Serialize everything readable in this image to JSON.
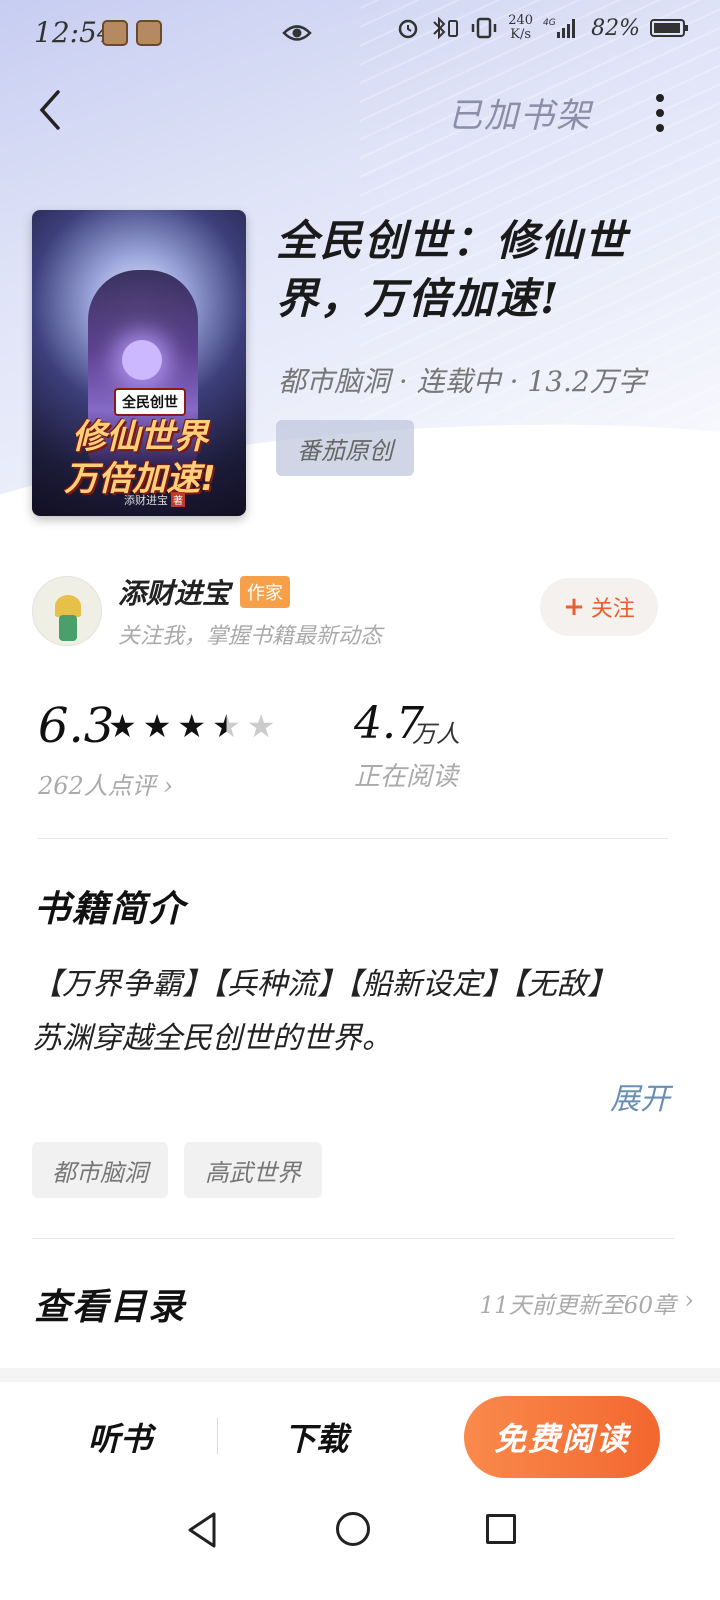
{
  "status_bar": {
    "time": "12:54",
    "speed_value": "240",
    "speed_unit": "K/s",
    "network": "4G",
    "battery": "82%"
  },
  "top_nav": {
    "shelf_label": "已加书架"
  },
  "book": {
    "cover_tag": "全民创世",
    "cover_title_line1": "修仙世界",
    "cover_title_line2": "万倍加速!",
    "cover_author": "添财进宝",
    "cover_author_badge": "著",
    "title": "全民创世：修仙世界，万倍加速!",
    "meta": "都市脑洞 · 连载中 · 13.2万字",
    "source_tag": "番茄原创"
  },
  "author": {
    "name": "添财进宝",
    "badge": "作家",
    "description": "关注我，掌握书籍最新动态",
    "follow_icon": "+",
    "follow_label": "关注"
  },
  "stats": {
    "score": "6.3",
    "stars_rating": 3.5,
    "stars_max": 5,
    "reviews_label": "262人点评 ›",
    "readers_count": "4.7",
    "readers_unit": "万人",
    "readers_label": "正在阅读"
  },
  "intro": {
    "heading": "书籍简介",
    "line1": "【万界争霸】【兵种流】【船新设定】【无敌】",
    "line2": "苏渊穿越全民创世的世界。",
    "expand_label": "展开",
    "tags": [
      "都市脑洞",
      "高武世界"
    ]
  },
  "catalog": {
    "heading": "查看目录",
    "info": "11天前更新至60章",
    "chevron": "›"
  },
  "actions": {
    "listen_label": "听书",
    "download_label": "下载",
    "read_label": "免费阅读"
  },
  "colors": {
    "accent": "#f2672f",
    "author_badge": "#f6a14a",
    "link": "#6b8fb3"
  }
}
